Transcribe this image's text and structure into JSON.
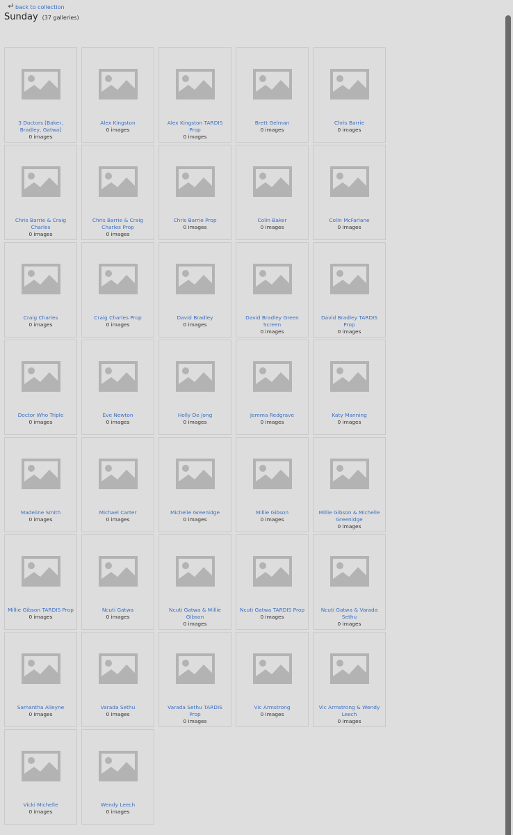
{
  "nav": {
    "back_label": "back to collection"
  },
  "header": {
    "title": "Sunday",
    "gallery_count": "(37 galleries)"
  },
  "galleries": [
    {
      "name": "3 Doctors [Baker, Bradley, Gatwa]",
      "count": "0 images"
    },
    {
      "name": "Alex Kingston",
      "count": "0 images"
    },
    {
      "name": "Alex Kingston TARDIS Prop",
      "count": "0 images"
    },
    {
      "name": "Brett Gelman",
      "count": "0 images"
    },
    {
      "name": "Chris Barrie",
      "count": "0 images"
    },
    {
      "name": "Chris Barrie & Craig Charles",
      "count": "0 images"
    },
    {
      "name": "Chris Barrie & Craig Charles Prop",
      "count": "0 images"
    },
    {
      "name": "Chris Barrie Prop",
      "count": "0 images"
    },
    {
      "name": "Colin Baker",
      "count": "0 images"
    },
    {
      "name": "Colin McFarlane",
      "count": "0 images"
    },
    {
      "name": "Craig Charles",
      "count": "0 images"
    },
    {
      "name": "Craig Charles Prop",
      "count": "0 images"
    },
    {
      "name": "David Bradley",
      "count": "0 images"
    },
    {
      "name": "David Bradley Green Screen",
      "count": "0 images"
    },
    {
      "name": "David Bradley TARDIS Prop",
      "count": "0 images"
    },
    {
      "name": "Doctor Who Triple",
      "count": "0 images"
    },
    {
      "name": "Eve Newton",
      "count": "0 images"
    },
    {
      "name": "Holly De Jong",
      "count": "0 images"
    },
    {
      "name": "Jemma Redgrave",
      "count": "0 images"
    },
    {
      "name": "Katy Manning",
      "count": "0 images"
    },
    {
      "name": "Madeline Smith",
      "count": "0 images"
    },
    {
      "name": "Michael Carter",
      "count": "0 images"
    },
    {
      "name": "Michelle Greenidge",
      "count": "0 images"
    },
    {
      "name": "Millie Gibson",
      "count": "0 images"
    },
    {
      "name": "Millie Gibson & Michelle Greenidge",
      "count": "0 images"
    },
    {
      "name": "Millie Gibson TARDIS Prop",
      "count": "0 images"
    },
    {
      "name": "Ncuti Gatwa",
      "count": "0 images"
    },
    {
      "name": "Ncuti Gatwa & Millie Gibson",
      "count": "0 images"
    },
    {
      "name": "Ncuti Gatwa TARDIS Prop",
      "count": "0 images"
    },
    {
      "name": "Ncuti Gatwa & Varada Sethu",
      "count": "0 images"
    },
    {
      "name": "Samantha Alleyne",
      "count": "0 images"
    },
    {
      "name": "Varada Sethu",
      "count": "0 images"
    },
    {
      "name": "Varada Sethu TARDIS Prop",
      "count": "0 images"
    },
    {
      "name": "Vic Armstrong",
      "count": "0 images"
    },
    {
      "name": "Vic Armstrong & Wendy Leech",
      "count": "0 images"
    },
    {
      "name": "Vicki Michelle",
      "count": "0 images"
    },
    {
      "name": "Wendy Leech",
      "count": "0 images"
    }
  ],
  "icons": {
    "back": "return-arrow-icon",
    "thumbnail": "image-placeholder-icon"
  },
  "colors": {
    "link": "#3a6fc4",
    "background": "#dedede",
    "placeholder": "#b3b3b3"
  }
}
